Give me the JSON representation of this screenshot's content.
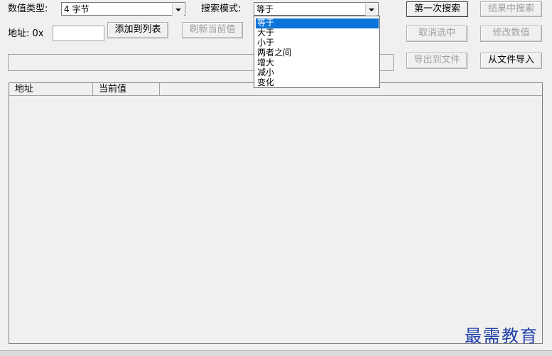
{
  "labels": {
    "value_type": "数值类型:",
    "search_mode": "搜索模式:",
    "address": "地址: 0x"
  },
  "value_type_combo": {
    "value": "4 字节"
  },
  "search_mode_combo": {
    "value": "等于",
    "options": [
      "等于",
      "大于",
      "小于",
      "两者之间",
      "增大",
      "减小",
      "变化"
    ],
    "selected_index": 0
  },
  "address_input": {
    "value": ""
  },
  "buttons": {
    "first_search": "第一次搜索",
    "search_in_results": "结果中搜索",
    "add_to_list": "添加到列表",
    "refresh_current": "刷新当前值",
    "deselect": "取消选中",
    "modify_value": "修改数值",
    "export_file": "导出到文件",
    "import_file": "从文件导入"
  },
  "list": {
    "columns": [
      "地址",
      "当前值"
    ]
  },
  "watermark": "最需教育"
}
